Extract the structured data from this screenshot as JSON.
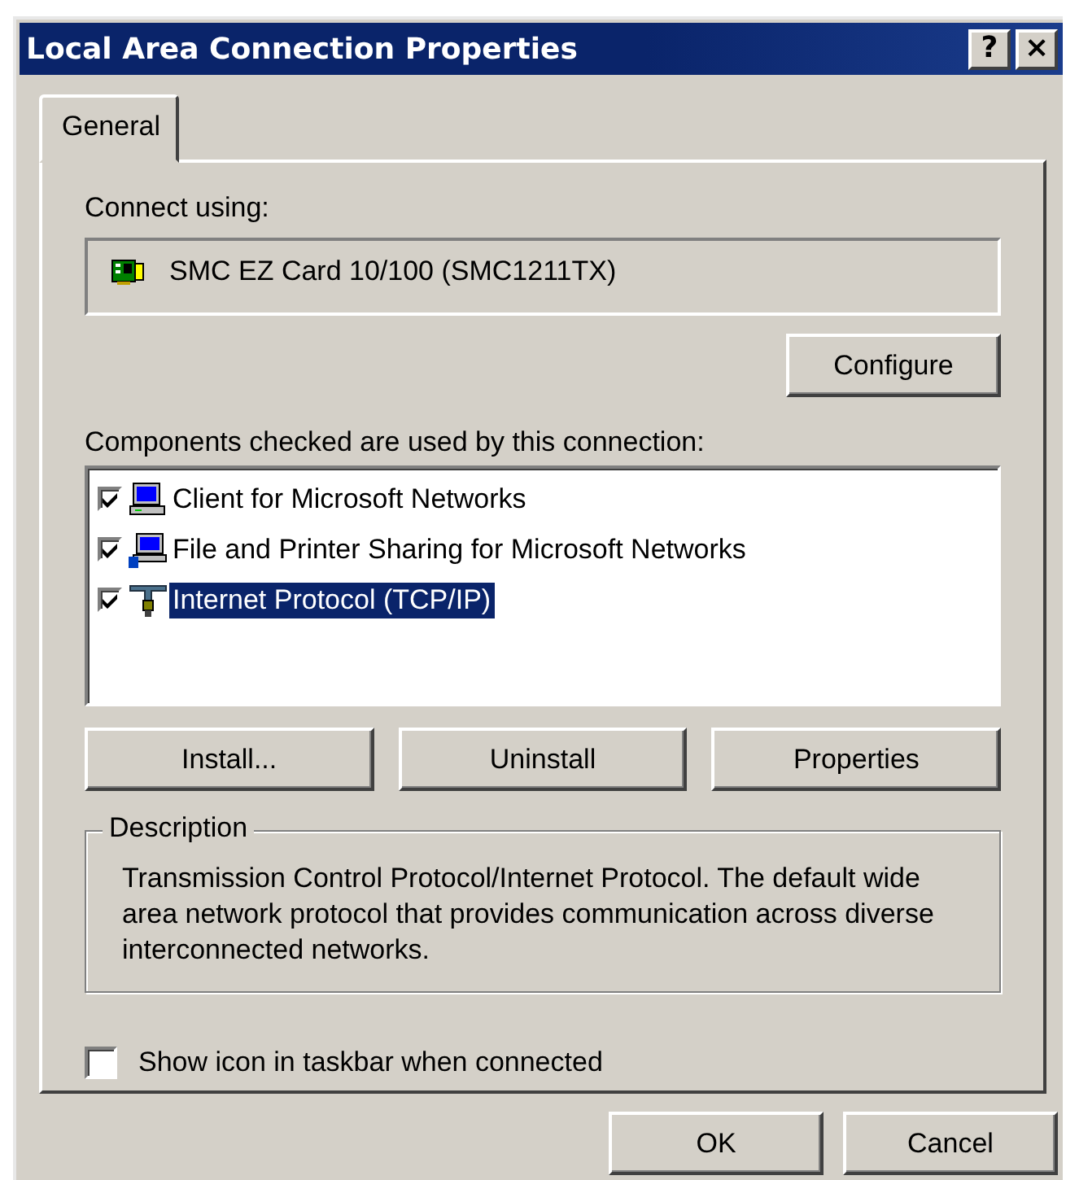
{
  "window": {
    "title": "Local Area Connection Properties",
    "title_buttons": [
      "?",
      "×"
    ]
  },
  "tabs": [
    {
      "label": "General",
      "selected": true
    }
  ],
  "connect_using": {
    "label": "Connect using:",
    "adapter": "SMC EZ Card 10/100 (SMC1211TX)",
    "configure_button": "Configure"
  },
  "components": {
    "label": "Components checked are used by this connection:",
    "items": [
      {
        "name": "Client for Microsoft Networks",
        "kind": "client",
        "checked": true,
        "selected": false
      },
      {
        "name": "File and Printer Sharing for Microsoft Networks",
        "kind": "service",
        "checked": true,
        "selected": false
      },
      {
        "name": "Internet Protocol (TCP/IP)",
        "kind": "protocol",
        "checked": true,
        "selected": true
      }
    ],
    "buttons": [
      "Install...",
      "Uninstall",
      "Properties"
    ]
  },
  "description": {
    "title": "Description",
    "text": "Transmission Control Protocol/Internet Protocol. The default wide area network protocol that provides communication across diverse interconnected networks."
  },
  "show_icon": {
    "label": "Show icon in taskbar when connected",
    "checked": false
  },
  "buttons": [
    "OK",
    "Cancel"
  ]
}
